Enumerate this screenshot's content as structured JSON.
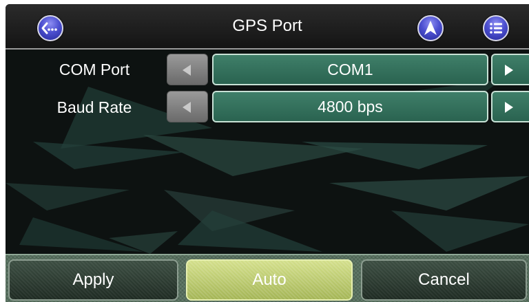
{
  "header": {
    "title": "GPS Port",
    "back_icon": "back-ellipsis-icon",
    "navigation_icon": "navigation-arrow-icon",
    "menu_icon": "list-menu-icon"
  },
  "settings": [
    {
      "label": "COM Port",
      "value": "COM1"
    },
    {
      "label": "Baud Rate",
      "value": "4800 bps"
    }
  ],
  "footer": {
    "apply_label": "Apply",
    "auto_label": "Auto",
    "cancel_label": "Cancel"
  },
  "colors": {
    "header_button": "#4c4fd0",
    "value_box": "#2f6b57",
    "auto_button": "#c0cf74",
    "footer_button": "#2b3a30",
    "background": "#0d1211"
  }
}
